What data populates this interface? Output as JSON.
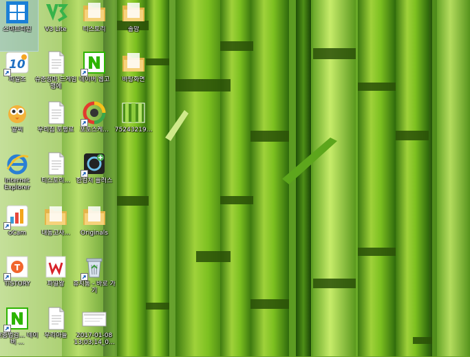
{
  "desktop": {
    "wallpaper": "bamboo-wallpaper",
    "icons": [
      {
        "label": "스마트피씬",
        "icon": "windows-tiles-icon"
      },
      {
        "label": "V3 Lite",
        "icon": "v3-lite-icon"
      },
      {
        "label": "티스토리",
        "icon": "folder-icon"
      },
      {
        "label": "솔맘",
        "icon": "folder-icon"
      },
      {
        "label": "파일조",
        "icon": "app-10-icon"
      },
      {
        "label": "슈준성마 드게임행에",
        "icon": "document-icon"
      },
      {
        "label": "네이버 웹고",
        "icon": "naver-icon"
      },
      {
        "label": "바탕화면",
        "icon": "folder-icon"
      },
      {
        "label": "알씨",
        "icon": "alsee-icon"
      },
      {
        "label": "우리집 토평료",
        "icon": "document-icon"
      },
      {
        "label": "포토스케...",
        "icon": "photoscape-icon"
      },
      {
        "label": "75243219...",
        "icon": "image-thumbnail-icon"
      },
      {
        "label": "Internet Explorer",
        "icon": "internet-explorer-icon"
      },
      {
        "label": "티스토리...",
        "icon": "document-icon"
      },
      {
        "label": "한컴처 플러스",
        "icon": "hancom-plus-icon"
      },
      {
        "label": "oCam",
        "icon": "ocam-icon"
      },
      {
        "label": "내동고사...",
        "icon": "folder-icon"
      },
      {
        "label": "Originals",
        "icon": "folder-icon"
      },
      {
        "label": "TISTORY",
        "icon": "tistory-icon"
      },
      {
        "label": "파일왕",
        "icon": "filewang-icon"
      },
      {
        "label": "휴지통 - 바로 가기",
        "icon": "recycle-bin-icon"
      },
      {
        "label": "맞춤법검... 네이버 ...",
        "icon": "naver-icon"
      },
      {
        "label": "우리아들",
        "icon": "document-icon"
      },
      {
        "label": "2017-01-08 13;03;14_0...",
        "icon": "screenshot-thumbnail-icon"
      }
    ]
  }
}
